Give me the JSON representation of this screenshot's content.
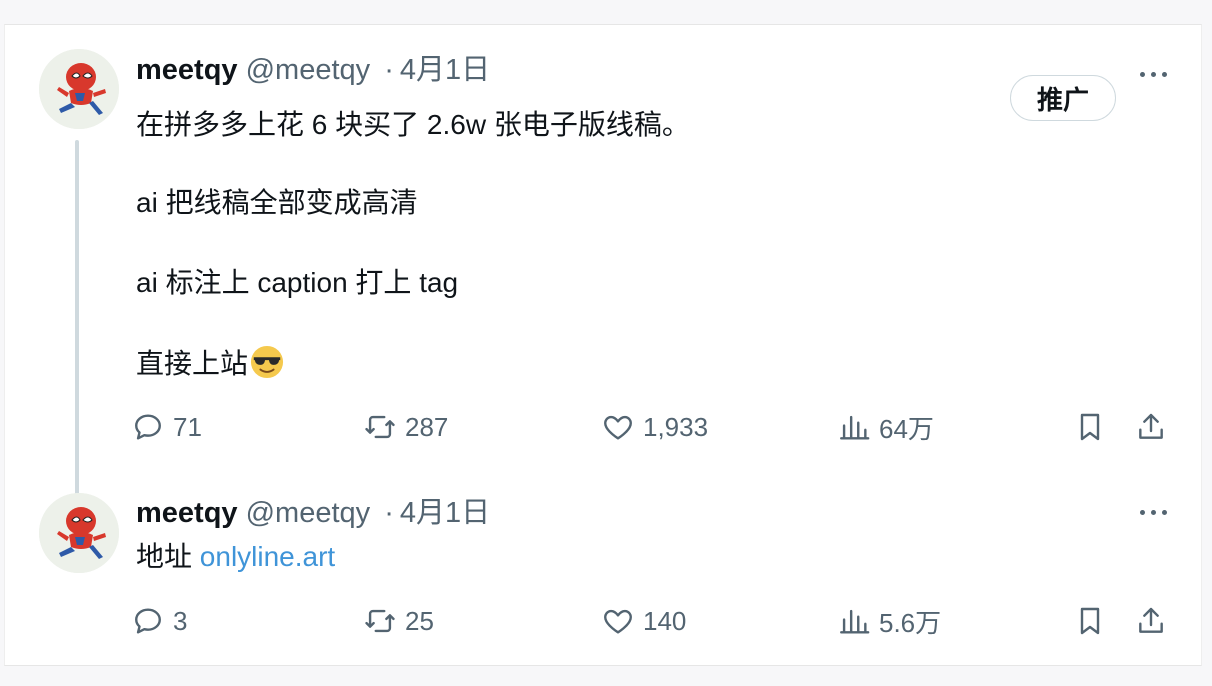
{
  "tweets": [
    {
      "display_name": "meetqy",
      "handle": "@meetqy",
      "separator": "·",
      "date": "4月1日",
      "promote_label": "推广",
      "lines": [
        "在拼多多上花 6 块买了 2.6w 张电子版线稿。",
        "ai 把线稿全部变成高清",
        "ai 标注上 caption 打上 tag",
        "直接上站"
      ],
      "emoji": "smiling-face-with-sunglasses",
      "stats": {
        "replies": "71",
        "retweets": "287",
        "likes": "1,933",
        "views": "64万"
      }
    },
    {
      "display_name": "meetqy",
      "handle": "@meetqy",
      "separator": "·",
      "date": "4月1日",
      "text_prefix": "地址",
      "link_text": "onlyline.art",
      "stats": {
        "replies": "3",
        "retweets": "25",
        "likes": "140",
        "views": "5.6万"
      }
    }
  ],
  "colors": {
    "text": "#0f1419",
    "muted": "#536471",
    "link": "#3f94d8",
    "thread_line": "#cfd9de"
  },
  "icons": [
    "reply-icon",
    "retweet-icon",
    "like-icon",
    "views-icon",
    "bookmark-icon",
    "share-icon",
    "more-icon"
  ]
}
